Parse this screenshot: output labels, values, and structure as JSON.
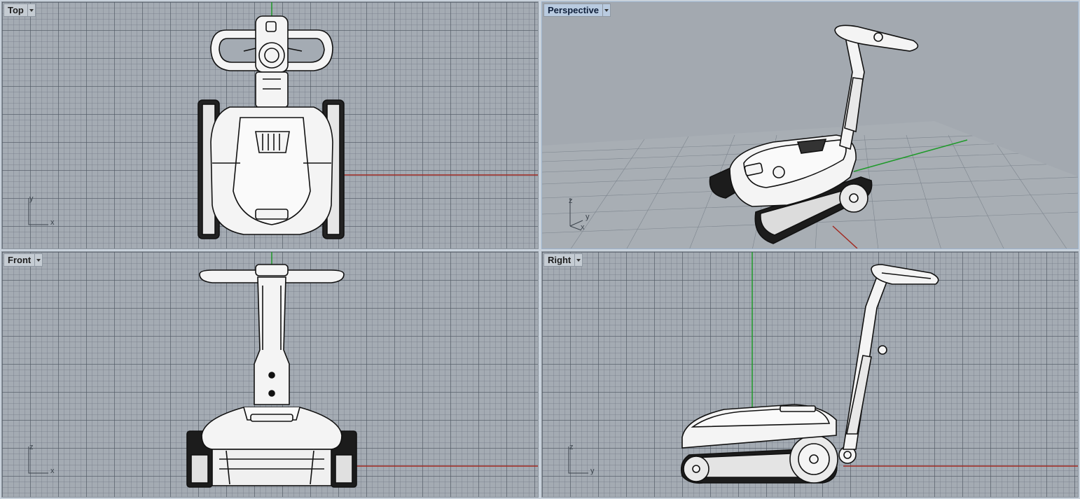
{
  "viewports": {
    "top": {
      "title": "Top",
      "axis_h": "x",
      "axis_v": "y"
    },
    "persp": {
      "title": "Perspective",
      "axis_x": "x",
      "axis_y": "y",
      "axis_z": "z"
    },
    "front": {
      "title": "Front",
      "axis_h": "x",
      "axis_v": "z"
    },
    "right": {
      "title": "Right",
      "axis_h": "y",
      "axis_v": "z"
    }
  },
  "colors": {
    "viewport_bg": "#a4abb3",
    "grid_line": "#4e5660",
    "x_axis": "#a22a22",
    "y_axis": "#1f9a2a",
    "active_title": "#b9cbe0",
    "model_fill": "#f4f4f4",
    "model_edge": "#111111"
  },
  "icons": [
    "dropdown-arrow-icon",
    "axis-indicator-icon"
  ]
}
